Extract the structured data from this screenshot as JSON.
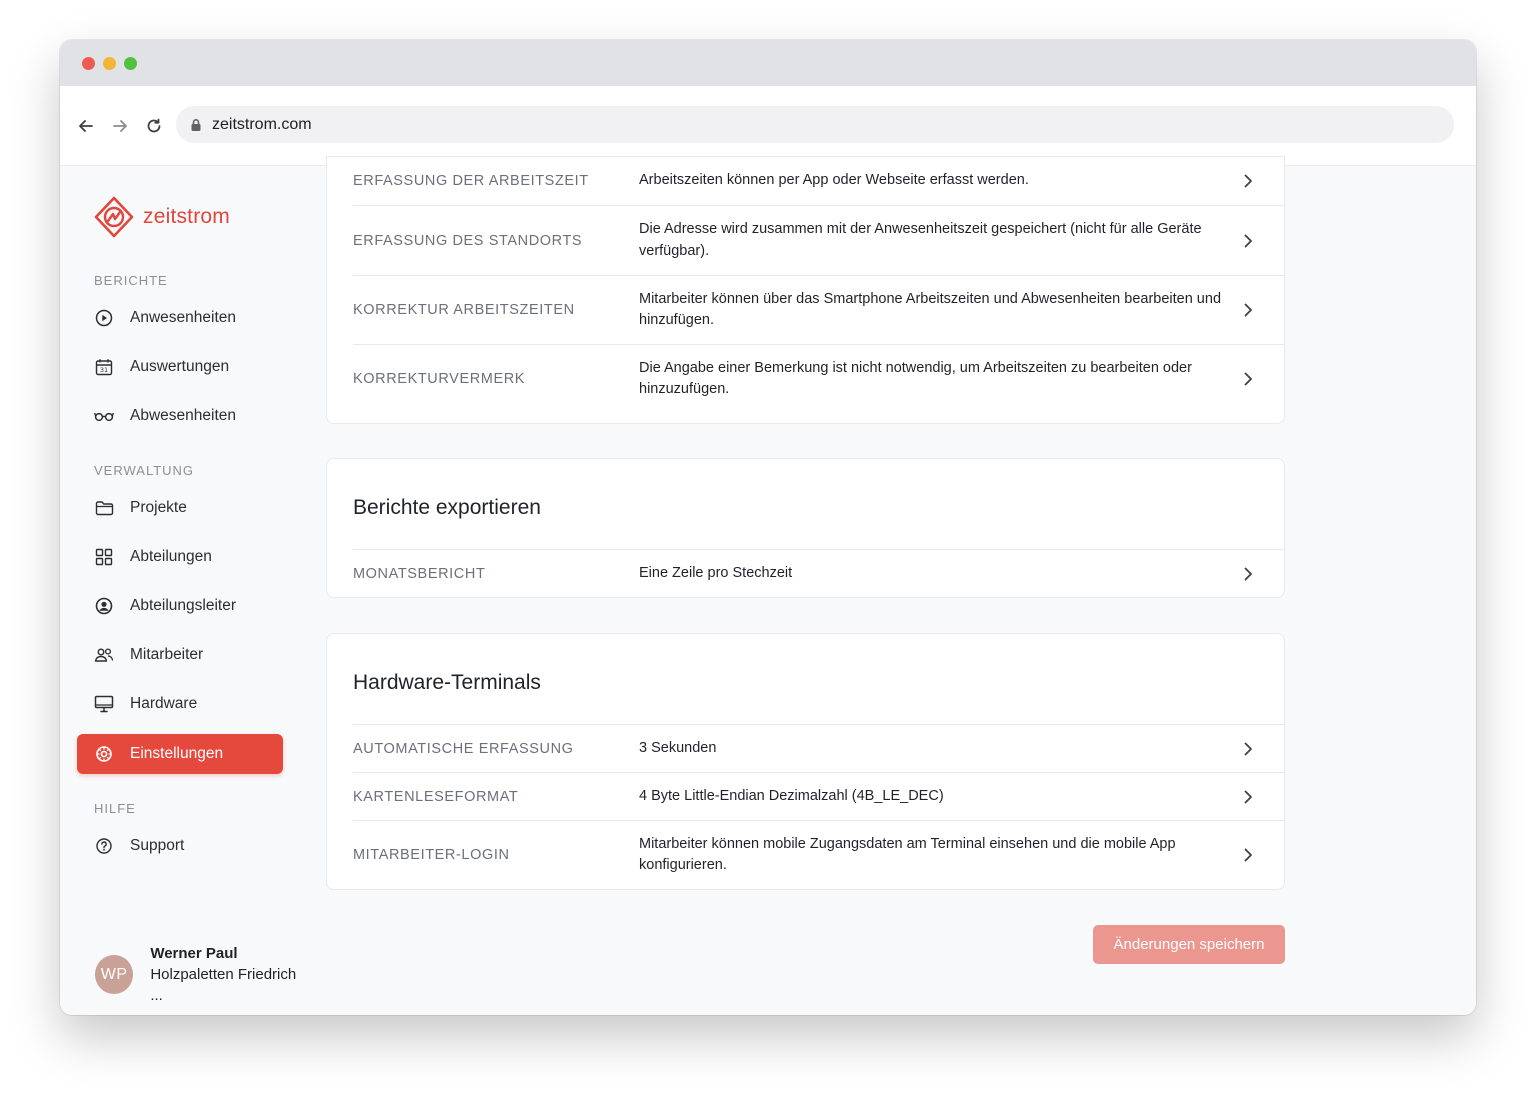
{
  "browser": {
    "url": "zeitstrom.com"
  },
  "sidebar": {
    "brand": "zeitstrom",
    "sections": {
      "berichte": "BERICHTE",
      "verwaltung": "VERWALTUNG",
      "hilfe": "HILFE"
    },
    "items": [
      {
        "label": "Anwesenheiten",
        "icon": "play-circle-icon"
      },
      {
        "label": "Auswertungen",
        "icon": "calendar-icon"
      },
      {
        "label": "Abwesenheiten",
        "icon": "glasses-icon"
      },
      {
        "label": "Projekte",
        "icon": "folder-icon"
      },
      {
        "label": "Abteilungen",
        "icon": "grid-icon"
      },
      {
        "label": "Abteilungsleiter",
        "icon": "user-circle-icon"
      },
      {
        "label": "Mitarbeiter",
        "icon": "users-icon"
      },
      {
        "label": "Hardware",
        "icon": "monitor-icon"
      },
      {
        "label": "Einstellungen",
        "icon": "gear-icon",
        "active": true
      },
      {
        "label": "Support",
        "icon": "help-circle-icon"
      }
    ],
    "user": {
      "initials": "WP",
      "name": "Werner Paul",
      "company": "Holzpaletten Friedrich ..."
    }
  },
  "settings": {
    "recording": {
      "rows": [
        {
          "label": "ERFASSUNG DER ARBEITSZEIT",
          "value": "Arbeitszeiten können per App oder Webseite erfasst werden."
        },
        {
          "label": "ERFASSUNG DES STANDORTS",
          "value": "Die Adresse wird zusammen mit der Anwesenheitszeit gespeichert (nicht für alle Geräte verfügbar)."
        },
        {
          "label": "KORREKTUR ARBEITSZEITEN",
          "value": "Mitarbeiter können über das Smartphone Arbeitszeiten und Abwesenheiten bearbeiten und hinzufügen."
        },
        {
          "label": "KORREKTURVERMERK",
          "value": "Die Angabe einer Bemerkung ist nicht notwendig, um Arbeitszeiten zu bearbeiten oder hinzuzufügen."
        }
      ]
    },
    "export": {
      "title": "Berichte exportieren",
      "rows": [
        {
          "label": "MONATSBERICHT",
          "value": "Eine Zeile pro Stechzeit"
        }
      ]
    },
    "hardware": {
      "title": "Hardware-Terminals",
      "rows": [
        {
          "label": "AUTOMATISCHE ERFASSUNG",
          "value": "3 Sekunden"
        },
        {
          "label": "KARTENLESEFORMAT",
          "value": "4 Byte Little-Endian Dezimalzahl (4B_LE_DEC)"
        },
        {
          "label": "MITARBEITER-LOGIN",
          "value": "Mitarbeiter können mobile Zugangsdaten am Terminal einsehen und die mobile App konfigurieren."
        }
      ]
    },
    "save_label": "Änderungen speichern"
  },
  "colors": {
    "accent": "#e5483d",
    "save_button": "#ec9690"
  }
}
